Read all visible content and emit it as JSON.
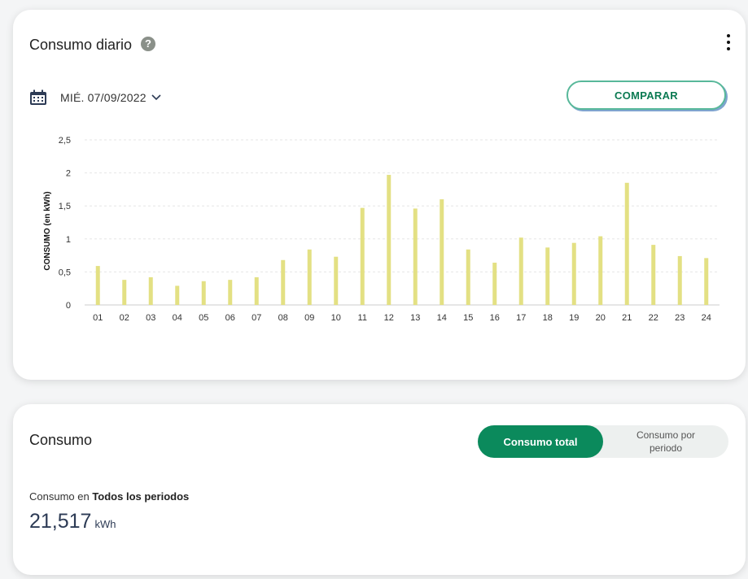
{
  "daily_card": {
    "title": "Consumo diario",
    "help_glyph": "?",
    "date_label": "MIÉ. 07/09/2022",
    "compare_label": "COMPARAR"
  },
  "consumo_card": {
    "title": "Consumo",
    "toggle": {
      "total": "Consumo total",
      "periodo": "Consumo por periodo"
    },
    "caption_prefix": "Consumo en ",
    "caption_period": "Todos los periodos",
    "value": "21,517",
    "unit": "kWh"
  },
  "chart_data": {
    "type": "bar",
    "title": "",
    "xlabel": "",
    "ylabel": "CONSUMO (en kWh)",
    "ylim": [
      0,
      2.5
    ],
    "yticks": [
      0,
      0.5,
      1,
      1.5,
      2,
      2.5
    ],
    "ytick_labels": [
      "0",
      "0,5",
      "1",
      "1,5",
      "2",
      "2,5"
    ],
    "grid": true,
    "bar_color": "#e3e083",
    "categories": [
      "01",
      "02",
      "03",
      "04",
      "05",
      "06",
      "07",
      "08",
      "09",
      "10",
      "11",
      "12",
      "13",
      "14",
      "15",
      "16",
      "17",
      "18",
      "19",
      "20",
      "21",
      "22",
      "23",
      "24"
    ],
    "values": [
      0.59,
      0.38,
      0.42,
      0.29,
      0.36,
      0.38,
      0.42,
      0.68,
      0.84,
      0.73,
      1.47,
      1.97,
      1.46,
      1.6,
      0.84,
      0.64,
      1.02,
      0.87,
      0.94,
      1.04,
      1.85,
      0.91,
      0.74,
      0.71
    ]
  }
}
